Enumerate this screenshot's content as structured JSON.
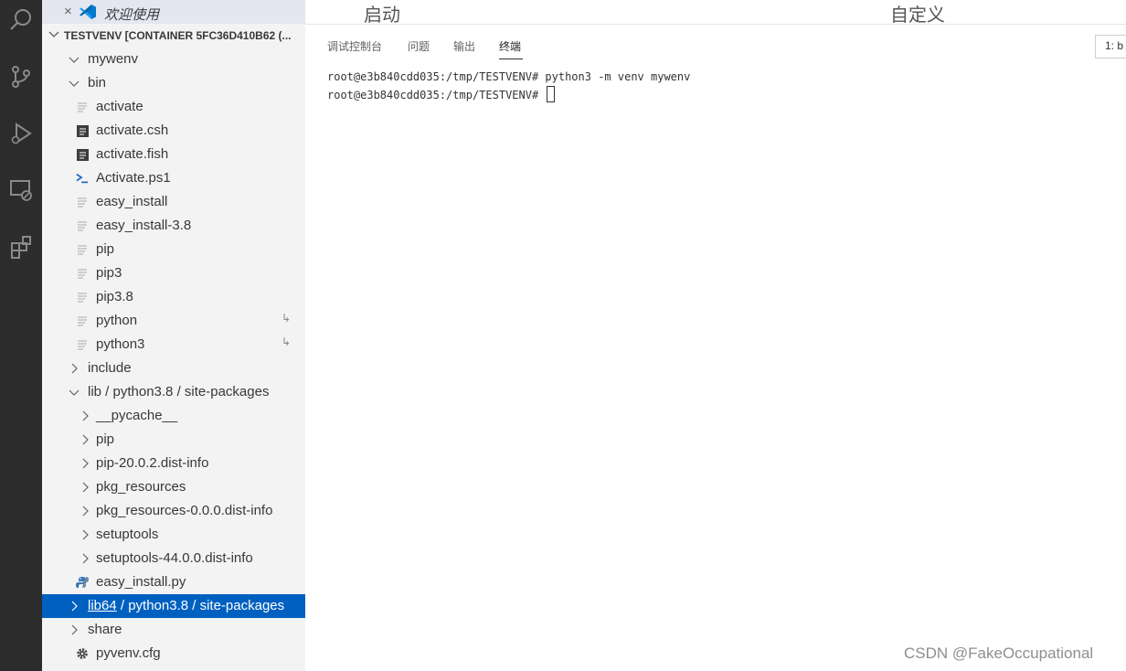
{
  "open_editor": {
    "close_glyph": "×",
    "icon": "vscode-logo-icon",
    "label": "欢迎使用"
  },
  "top": {
    "left": "启动",
    "right": "自定义"
  },
  "explorer": {
    "folder_title": "TESTVENV [CONTAINER 5FC36D410B62 (...",
    "items": [
      {
        "label": "mywenv",
        "kind": "folder-open",
        "level": 0
      },
      {
        "label": "bin",
        "kind": "folder-open",
        "level": 1
      },
      {
        "label": "activate",
        "kind": "file",
        "icon": "plain-file-icon",
        "level": 2
      },
      {
        "label": "activate.csh",
        "kind": "file",
        "icon": "shell-file-icon",
        "level": 2
      },
      {
        "label": "activate.fish",
        "kind": "file",
        "icon": "shell-file-icon",
        "level": 2
      },
      {
        "label": "Activate.ps1",
        "kind": "file",
        "icon": "powershell-icon",
        "level": 2
      },
      {
        "label": "easy_install",
        "kind": "file",
        "icon": "plain-file-icon",
        "level": 2
      },
      {
        "label": "easy_install-3.8",
        "kind": "file",
        "icon": "plain-file-icon",
        "level": 2
      },
      {
        "label": "pip",
        "kind": "file",
        "icon": "plain-file-icon",
        "level": 2
      },
      {
        "label": "pip3",
        "kind": "file",
        "icon": "plain-file-icon",
        "level": 2
      },
      {
        "label": "pip3.8",
        "kind": "file",
        "icon": "plain-file-icon",
        "level": 2
      },
      {
        "label": "python",
        "kind": "file",
        "icon": "plain-file-icon",
        "level": 2,
        "symlink": "↳"
      },
      {
        "label": "python3",
        "kind": "file",
        "icon": "plain-file-icon",
        "level": 2,
        "symlink": "↳"
      },
      {
        "label": "include",
        "kind": "folder-closed",
        "level": 1
      },
      {
        "label": "lib / python3.8 / site-packages",
        "kind": "folder-open",
        "level": 1
      },
      {
        "label": "__pycache__",
        "kind": "folder-closed",
        "level": 2
      },
      {
        "label": "pip",
        "kind": "folder-closed",
        "level": 2
      },
      {
        "label": "pip-20.0.2.dist-info",
        "kind": "folder-closed",
        "level": 2
      },
      {
        "label": "pkg_resources",
        "kind": "folder-closed",
        "level": 2
      },
      {
        "label": "pkg_resources-0.0.0.dist-info",
        "kind": "folder-closed",
        "level": 2
      },
      {
        "label": "setuptools",
        "kind": "folder-closed",
        "level": 2
      },
      {
        "label": "setuptools-44.0.0.dist-info",
        "kind": "folder-closed",
        "level": 2
      },
      {
        "label": "easy_install.py",
        "kind": "file",
        "icon": "python-file-icon",
        "level": 2
      },
      {
        "label": "lib64",
        "label_rest": " / python3.8 / site-packages",
        "kind": "folder-closed",
        "level": 1,
        "selected": true
      },
      {
        "label": "share",
        "kind": "folder-closed",
        "level": 1
      },
      {
        "label": "pyvenv.cfg",
        "kind": "file",
        "icon": "gear-icon",
        "level": 1
      }
    ]
  },
  "panel": {
    "tabs": [
      "调试控制台",
      "问题",
      "输出",
      "终端"
    ],
    "active_tab": "终端",
    "terminal_selector": "1: b"
  },
  "terminal": {
    "lines": [
      "root@e3b840cdd035:/tmp/TESTVENV# python3 -m venv mywenv",
      "root@e3b840cdd035:/tmp/TESTVENV# "
    ]
  },
  "watermark": "CSDN @FakeOccupational",
  "colors": {
    "activity_bar": "#2c2c2c",
    "sidebar": "#f3f3f3",
    "selection": "#0060c0",
    "vscode_blue": "#007acc"
  }
}
